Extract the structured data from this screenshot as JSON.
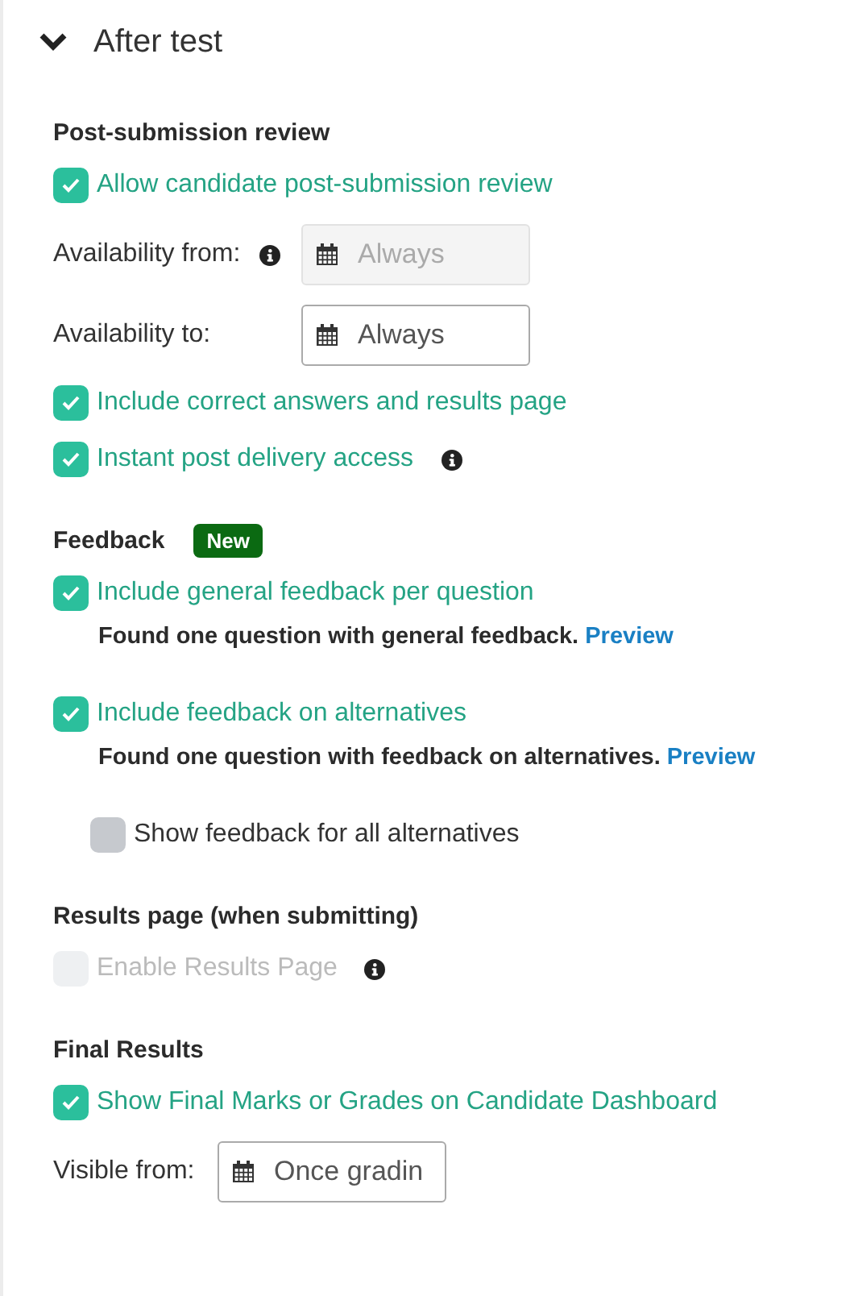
{
  "header": {
    "title": "After test",
    "expanded": true
  },
  "sections": [
    {
      "title": "Post-submission review",
      "items": [
        {
          "kind": "checkbox",
          "label": "Allow candidate post-submission review",
          "checked": true,
          "disabled": false
        },
        {
          "kind": "date",
          "label": "Availability from:",
          "info": true,
          "value": "Always",
          "disabled": true
        },
        {
          "kind": "date",
          "label": "Availability to:",
          "value": "Always",
          "disabled": false
        },
        {
          "kind": "checkbox",
          "label": "Include correct answers and results page",
          "checked": true,
          "disabled": false
        },
        {
          "kind": "checkbox",
          "label": "Instant post delivery access",
          "checked": true,
          "disabled": false,
          "info": true
        }
      ]
    },
    {
      "title": "Feedback",
      "badge": "New",
      "items": [
        {
          "kind": "checkbox",
          "label": "Include general feedback per question",
          "checked": true,
          "disabled": false,
          "note": {
            "text": "Found one question with general feedback.",
            "link": "Preview"
          }
        },
        {
          "kind": "checkbox",
          "label": "Include feedback on alternatives",
          "checked": true,
          "disabled": false,
          "note": {
            "text": "Found one question with feedback on alternatives.",
            "link": "Preview"
          },
          "children": [
            {
              "kind": "checkbox",
              "label": "Show feedback for all alternatives",
              "checked": false,
              "disabled": false
            }
          ]
        }
      ]
    },
    {
      "title": "Results page (when submitting)",
      "items": [
        {
          "kind": "checkbox",
          "label": "Enable Results Page",
          "checked": false,
          "disabled": true,
          "info": true
        }
      ]
    },
    {
      "title": "Final Results",
      "items": [
        {
          "kind": "checkbox",
          "label": "Show Final Marks or Grades on Candidate Dashboard",
          "checked": true,
          "disabled": false
        },
        {
          "kind": "date",
          "label": "Visible from:",
          "value": "Once gradin",
          "disabled": false
        }
      ]
    }
  ]
}
